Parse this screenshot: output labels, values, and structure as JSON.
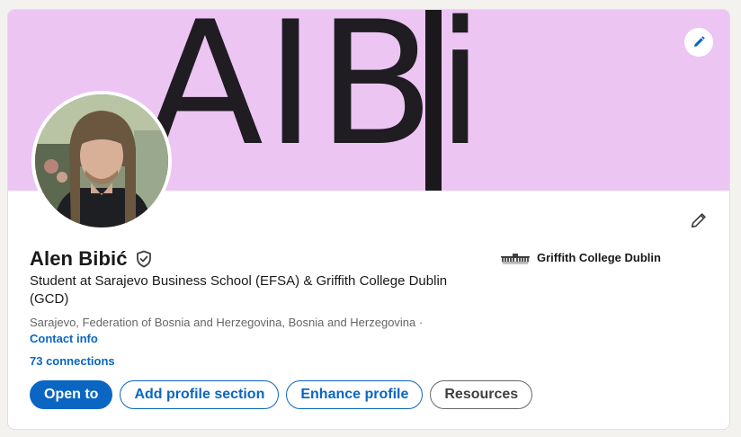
{
  "banner": {
    "text": "AIBi",
    "edit_icon": "pencil-icon",
    "background": "#ecc5f3"
  },
  "profile": {
    "name": "Alen Bibić",
    "verified_icon": "verified-shield-icon",
    "headline": "Student at Sarajevo Business School (EFSA) & Griffith College Dublin (GCD)",
    "location": "Sarajevo, Federation of Bosnia and Herzegovina, Bosnia and Herzegovina ·",
    "contact_label": "Contact info",
    "connections_label": "73 connections",
    "edit_icon": "pencil-icon"
  },
  "education": {
    "school_name": "Griffith College Dublin",
    "logo_icon": "griffith-college-logo-icon"
  },
  "actions": {
    "open_to": "Open to",
    "add_section": "Add profile section",
    "enhance": "Enhance profile",
    "resources": "Resources"
  },
  "colors": {
    "accent": "#0a66c2",
    "page_bg": "#f3f2ef"
  }
}
